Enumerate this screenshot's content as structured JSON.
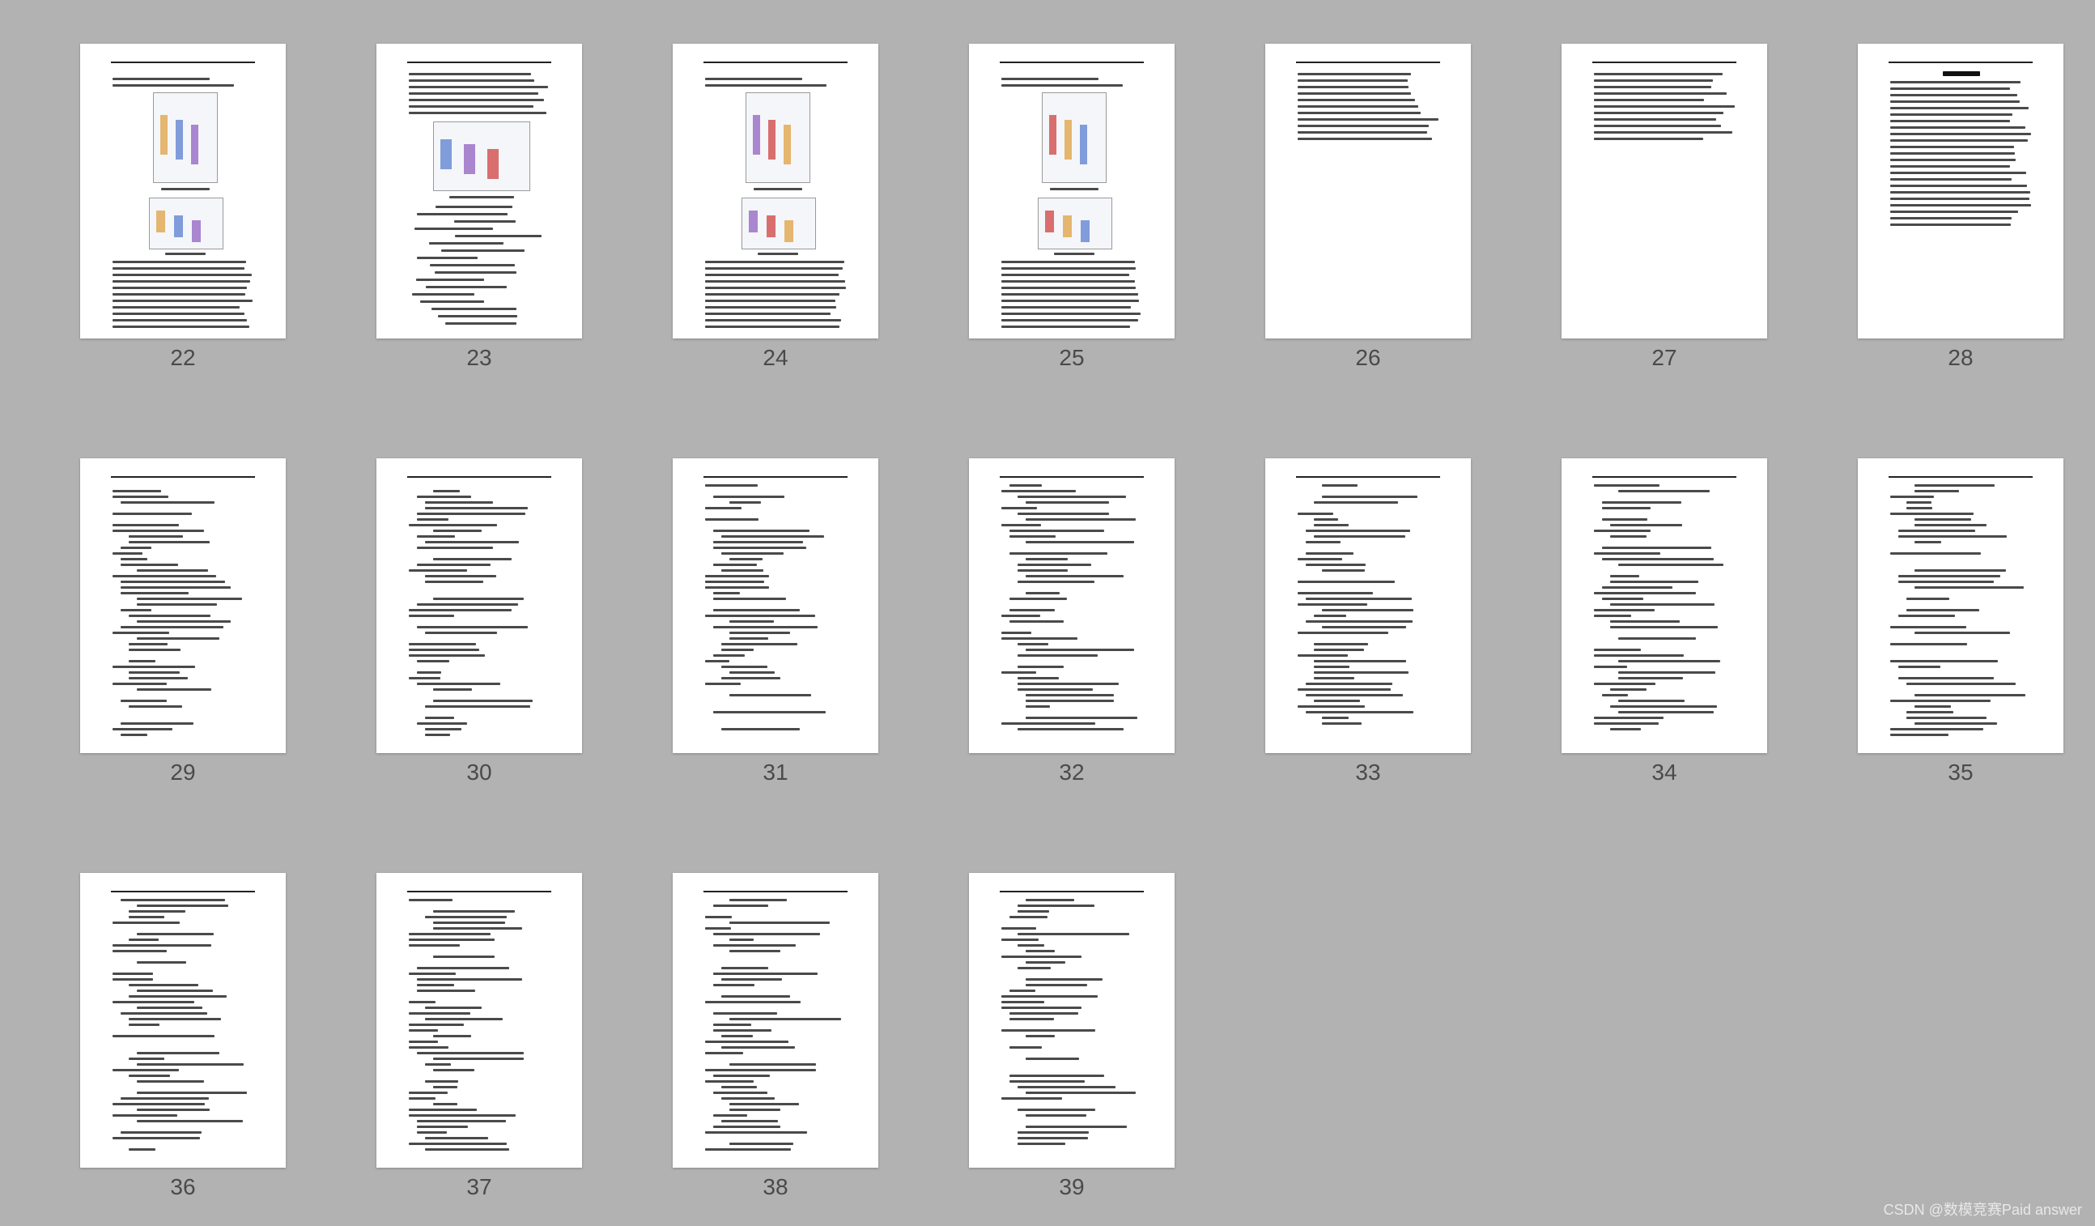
{
  "pages": [
    {
      "number": "22",
      "layout": "figs2"
    },
    {
      "number": "23",
      "layout": "figs1"
    },
    {
      "number": "24",
      "layout": "figs2"
    },
    {
      "number": "25",
      "layout": "figs2"
    },
    {
      "number": "26",
      "layout": "short"
    },
    {
      "number": "27",
      "layout": "short"
    },
    {
      "number": "28",
      "layout": "text"
    },
    {
      "number": "29",
      "layout": "code"
    },
    {
      "number": "30",
      "layout": "code"
    },
    {
      "number": "31",
      "layout": "code"
    },
    {
      "number": "32",
      "layout": "code"
    },
    {
      "number": "33",
      "layout": "code"
    },
    {
      "number": "34",
      "layout": "code"
    },
    {
      "number": "35",
      "layout": "code"
    },
    {
      "number": "36",
      "layout": "code"
    },
    {
      "number": "37",
      "layout": "code"
    },
    {
      "number": "38",
      "layout": "code"
    },
    {
      "number": "39",
      "layout": "code"
    }
  ],
  "watermark": "CSDN @数模竞赛Paid answer",
  "colors": {
    "background": "#b2b2b2",
    "page": "#ffffff",
    "page_number": "#4a4a4a"
  }
}
